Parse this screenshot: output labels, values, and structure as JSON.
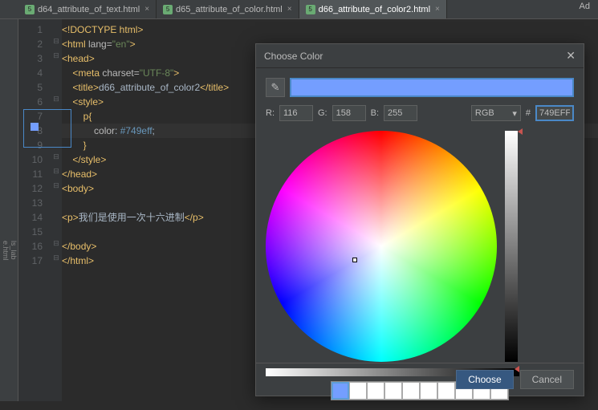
{
  "topRight": "Ad",
  "sidebar": {
    "item1": "ls_lab",
    "item2": "e.html"
  },
  "tabs": [
    {
      "label": "d64_attribute_of_text.html",
      "active": false
    },
    {
      "label": "d65_attribute_of_color.html",
      "active": false
    },
    {
      "label": "d66_attribute_of_color2.html",
      "active": true
    }
  ],
  "code": {
    "l1": "<!DOCTYPE html>",
    "l2_open": "<html ",
    "l2_attr": "lang=",
    "l2_val": "\"en\"",
    "l2_close": ">",
    "l3": "<head>",
    "l4_open": "<meta ",
    "l4_attr": "charset=",
    "l4_val": "\"UTF-8\"",
    "l4_close": ">",
    "l5_open": "<title>",
    "l5_txt": "d66_attribute_of_color2",
    "l5_close": "</title>",
    "l6": "<style>",
    "l7": "p{",
    "l8_prop": "color",
    "l8_sep": ": ",
    "l8_val": "#749eff",
    "l8_end": ";",
    "l9": "}",
    "l10": "</style>",
    "l11": "</head>",
    "l12": "<body>",
    "l14_open": "<p>",
    "l14_txt": "我们是使用一次十六进制",
    "l14_close": "</p>",
    "l16": "</body>",
    "l17": "</html>"
  },
  "lines": [
    "1",
    "2",
    "3",
    "4",
    "5",
    "6",
    "7",
    "8",
    "9",
    "10",
    "11",
    "12",
    "13",
    "14",
    "15",
    "16",
    "17"
  ],
  "dialog": {
    "title": "Choose Color",
    "r_label": "R:",
    "r": "116",
    "g_label": "G:",
    "g": "158",
    "b_label": "B:",
    "b": "255",
    "mode": "RGB",
    "hash": "#",
    "hex": "749EFF",
    "choose": "Choose",
    "cancel": "Cancel"
  }
}
